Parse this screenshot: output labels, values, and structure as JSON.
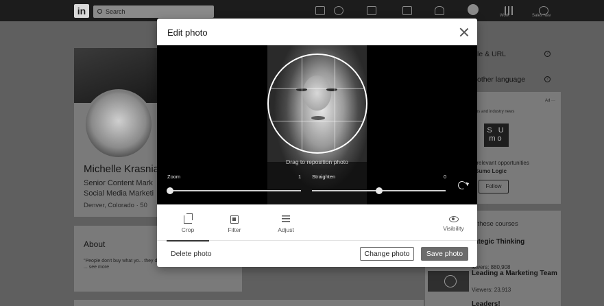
{
  "nav": {
    "logo": "in",
    "search_placeholder": "Search",
    "work_label": "Work",
    "sales_nav_label": "Sales Nav"
  },
  "profile": {
    "name": "Michelle Krasnia",
    "headline_1": "Senior Content Mark",
    "headline_2": "Social Media Marketi",
    "location": "Denver, Colorado · 50",
    "about_title": "About",
    "about_text": "\"People don't buy what yo... they do WHAT they do. \" - Simon Sinek",
    "see_more": "... see more"
  },
  "sidebar": {
    "profile_url": "le & URL",
    "other_language": "other language",
    "ad_label": "Ad ···",
    "ad_sub": "t jobs and industry news",
    "sumo_logo": "S U\nmo",
    "ad_opportunities": "re relevant opportunities",
    "ad_company": "h Sumo Logic",
    "follow": "Follow",
    "courses_head": "th these courses",
    "course_1": "rategic Thinking",
    "course_1_meta": "iewers: 880,908",
    "course_2": "Leading a Marketing Team",
    "course_2_meta": "Viewers: 23,913",
    "course_3": "Leaders!"
  },
  "modal": {
    "title": "Edit photo",
    "hint": "Drag to reposition photo",
    "zoom_label": "Zoom",
    "zoom_value": "1",
    "straighten_label": "Straighten",
    "straighten_value": "0",
    "zoom_level": 0.0,
    "straighten_level": 0.5,
    "tools": {
      "crop": "Crop",
      "filter": "Filter",
      "adjust": "Adjust",
      "visibility": "Visibility"
    },
    "delete_label": "Delete photo",
    "change_label": "Change photo",
    "save_label": "Save photo"
  }
}
